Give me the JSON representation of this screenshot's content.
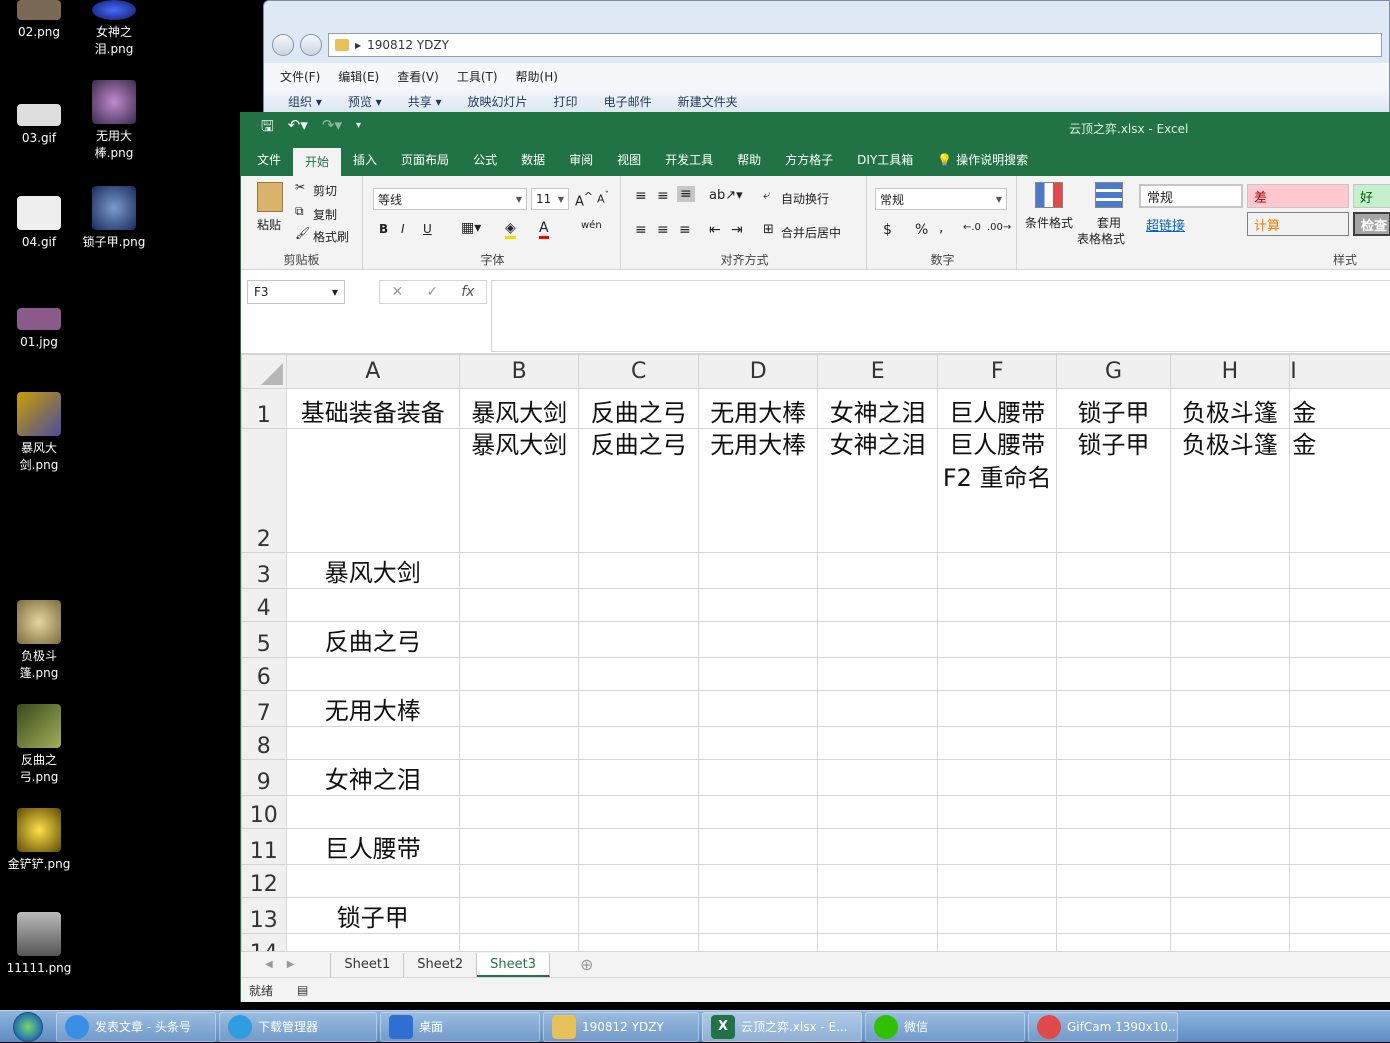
{
  "desktop": {
    "icons": [
      {
        "label": "02.png",
        "color": "#7a6a55"
      },
      {
        "label": "女神之泪.png",
        "color": "#2340b0"
      },
      {
        "label": "03.gif",
        "color": "#dddddd"
      },
      {
        "label": "无用大棒.png",
        "color": "#7a5a8a"
      },
      {
        "label": "04.gif",
        "color": "#eeeeee"
      },
      {
        "label": "锁子甲.png",
        "color": "#4a6090"
      },
      {
        "label": "01.jpg",
        "color": "#8a5a8a"
      },
      {
        "label": "暴风大剑.png",
        "color": "#5a5aa0"
      },
      {
        "label": "负极斗篷.png",
        "color": "#b7a06a"
      },
      {
        "label": "反曲之弓.png",
        "color": "#6a7a3a"
      },
      {
        "label": "金铲铲.png",
        "color": "#c9a000"
      },
      {
        "label": "11111.png",
        "color": "#777766"
      }
    ]
  },
  "explorer": {
    "path": "190812 YDZY",
    "menu": [
      "文件(F)",
      "编辑(E)",
      "查看(V)",
      "工具(T)",
      "帮助(H)"
    ],
    "tools": [
      "组织 ▾",
      "预览 ▾",
      "共享 ▾",
      "放映幻灯片",
      "打印",
      "电子邮件",
      "新建文件夹"
    ]
  },
  "excel": {
    "title": "云顶之弈.xlsx  -  Excel",
    "ribbon_tabs": [
      "文件",
      "开始",
      "插入",
      "页面布局",
      "公式",
      "数据",
      "审阅",
      "视图",
      "开发工具",
      "帮助",
      "方方格子",
      "DIY工具箱",
      "操作说明搜索"
    ],
    "active_tab": "开始",
    "clipboard": {
      "paste": "粘贴",
      "cut": "剪切",
      "copy": "复制",
      "painter": "格式刷",
      "group": "剪贴板"
    },
    "font": {
      "name": "等线",
      "size": "11",
      "bold": "B",
      "italic": "I",
      "underline": "U",
      "group": "字体"
    },
    "alignment": {
      "wrap": "自动换行",
      "merge": "合并后居中",
      "group": "对齐方式"
    },
    "number": {
      "format": "常规",
      "currency": "$",
      "percent": "%",
      "comma": ",",
      "group": "数字"
    },
    "styles": {
      "cond": "条件格式",
      "table1": "套用",
      "table2": "表格格式",
      "normal": "常规",
      "bad": "差",
      "good": "好",
      "hyperlink": "超链接",
      "calc": "计算",
      "check": "检查",
      "group": "样式"
    },
    "name_box": "F3",
    "fx": "fx",
    "columns": [
      "A",
      "B",
      "C",
      "D",
      "E",
      "F",
      "G",
      "H",
      "I"
    ],
    "rows": [
      {
        "num": "1",
        "cells": [
          "基础装备装备",
          "暴风大剑",
          "反曲之弓",
          "无用大棒",
          "女神之泪",
          "巨人腰带",
          "锁子甲",
          "负极斗篷",
          "金"
        ]
      },
      {
        "num": "2",
        "cells": [
          "",
          "暴风大剑",
          "反曲之弓",
          "无用大棒",
          "女神之泪",
          "巨人腰带F2 重命名",
          "锁子甲",
          "负极斗篷",
          "金"
        ]
      },
      {
        "num": "3",
        "cells": [
          "暴风大剑",
          "",
          "",
          "",
          "",
          "",
          "",
          "",
          ""
        ]
      },
      {
        "num": "4",
        "cells": [
          "",
          "",
          "",
          "",
          "",
          "",
          "",
          "",
          ""
        ]
      },
      {
        "num": "5",
        "cells": [
          "反曲之弓",
          "",
          "",
          "",
          "",
          "",
          "",
          "",
          ""
        ]
      },
      {
        "num": "6",
        "cells": [
          "",
          "",
          "",
          "",
          "",
          "",
          "",
          "",
          ""
        ]
      },
      {
        "num": "7",
        "cells": [
          "无用大棒",
          "",
          "",
          "",
          "",
          "",
          "",
          "",
          ""
        ]
      },
      {
        "num": "8",
        "cells": [
          "",
          "",
          "",
          "",
          "",
          "",
          "",
          "",
          ""
        ]
      },
      {
        "num": "9",
        "cells": [
          "女神之泪",
          "",
          "",
          "",
          "",
          "",
          "",
          "",
          ""
        ]
      },
      {
        "num": "10",
        "cells": [
          "",
          "",
          "",
          "",
          "",
          "",
          "",
          "",
          ""
        ]
      },
      {
        "num": "11",
        "cells": [
          "巨人腰带",
          "",
          "",
          "",
          "",
          "",
          "",
          "",
          ""
        ]
      },
      {
        "num": "12",
        "cells": [
          "",
          "",
          "",
          "",
          "",
          "",
          "",
          "",
          ""
        ]
      },
      {
        "num": "13",
        "cells": [
          "锁子甲",
          "",
          "",
          "",
          "",
          "",
          "",
          "",
          ""
        ]
      },
      {
        "num": "14",
        "cells": [
          "",
          "",
          "",
          "",
          "",
          "",
          "",
          "",
          ""
        ]
      }
    ],
    "sheets": [
      "Sheet1",
      "Sheet2",
      "Sheet3"
    ],
    "active_sheet": "Sheet3",
    "status": "就绪",
    "accent": "#217346"
  },
  "taskbar": {
    "items": [
      {
        "label": "发表文章 - 头条号",
        "color": "#3a8ee6"
      },
      {
        "label": "下载管理器",
        "color": "#2f9de0"
      },
      {
        "label": "桌面",
        "color": "#2e6fd1"
      },
      {
        "label": "190812 YDZY",
        "color": "#e8c15a"
      },
      {
        "label": "云顶之弈.xlsx - E...",
        "color": "#217346"
      },
      {
        "label": "微信",
        "color": "#2dc100"
      },
      {
        "label": "GifCam 1390x10...",
        "color": "#e04a4a"
      }
    ]
  }
}
